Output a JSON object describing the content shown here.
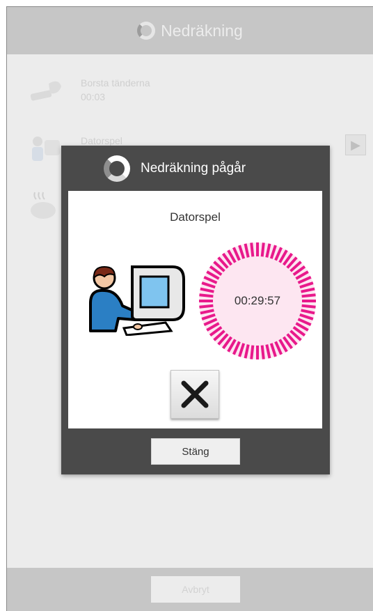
{
  "app": {
    "title": "Nedräkning"
  },
  "list": [
    {
      "name": "Borsta tänderna",
      "time": "00:03",
      "icon": "toothbrush-icon"
    },
    {
      "name": "Datorspel",
      "time": "",
      "icon": "computer-user-icon"
    },
    {
      "name": "",
      "time": "",
      "icon": "cooking-pot-icon"
    }
  ],
  "bottom": {
    "cancel_label": "Avbryt"
  },
  "dialog": {
    "title": "Nedräkning pågår",
    "activity": "Datorspel",
    "timer": "00:29:57",
    "close_label": "Stäng",
    "colors": {
      "timer_accent": "#e8198b",
      "timer_fill": "#fde6f1"
    }
  }
}
